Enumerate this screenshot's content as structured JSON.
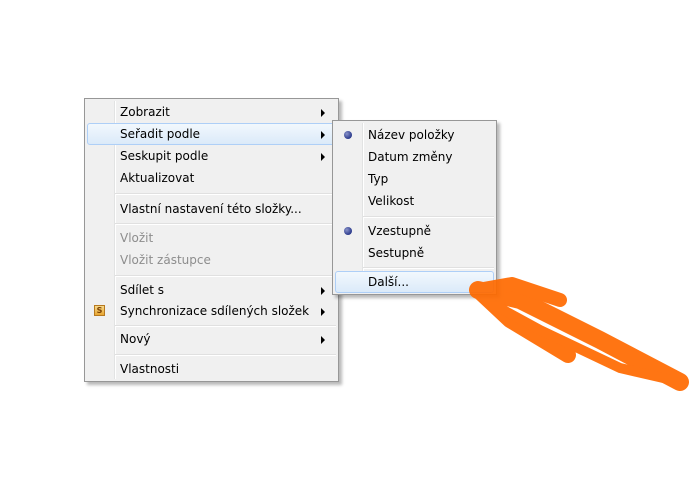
{
  "context_menu": {
    "items": [
      {
        "label": "Zobrazit"
      },
      {
        "label": "Seřadit podle"
      },
      {
        "label": "Seskupit podle"
      },
      {
        "label": "Aktualizovat"
      },
      {
        "label": "Vlastní nastavení této složky..."
      },
      {
        "label": "Vložit"
      },
      {
        "label": "Vložit zástupce"
      },
      {
        "label": "Sdílet s"
      },
      {
        "label": "Synchronizace sdílených složek",
        "icon": "sync-icon",
        "icon_glyph": "S"
      },
      {
        "label": "Nový"
      },
      {
        "label": "Vlastnosti"
      }
    ]
  },
  "submenu": {
    "items": [
      {
        "label": "Název položky",
        "checked": true
      },
      {
        "label": "Datum změny"
      },
      {
        "label": "Typ"
      },
      {
        "label": "Velikost"
      },
      {
        "label": "Vzestupně",
        "checked": true
      },
      {
        "label": "Sestupně"
      },
      {
        "label": "Další..."
      }
    ]
  },
  "annotation": {
    "color": "#ff6a00",
    "icon": "arrow-annotation"
  }
}
